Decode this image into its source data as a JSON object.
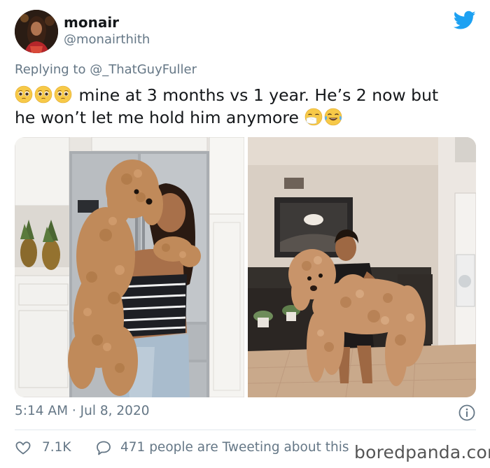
{
  "tweet": {
    "display_name": "monair",
    "handle": "@monairthith",
    "replying_prefix": "Replying to",
    "replying_to": "@_ThatGuyFuller",
    "text_line1": "mine at 3 months vs 1 year. He’s 2 now but",
    "text_line2": "he won’t let me hold him anymore",
    "timestamp": "5:14 AM · Jul 8, 2020",
    "like_count": "7.1K",
    "tweeting_text": "471 people are Tweeting about this"
  },
  "icons": {
    "brand": "twitter-bird-icon",
    "info": "info-icon",
    "like": "heart-icon",
    "reply": "speech-bubble-icon",
    "emoji_leading": "pleading-face-emoji",
    "emoji_trailing_1": "sneezing-face-emoji",
    "emoji_trailing_2": "face-with-tears-of-joy-emoji"
  },
  "colors": {
    "twitter_blue": "#1da1f2",
    "secondary_text": "#657786",
    "divider": "#e1e8ed"
  },
  "watermark": "boredpanda.com"
}
